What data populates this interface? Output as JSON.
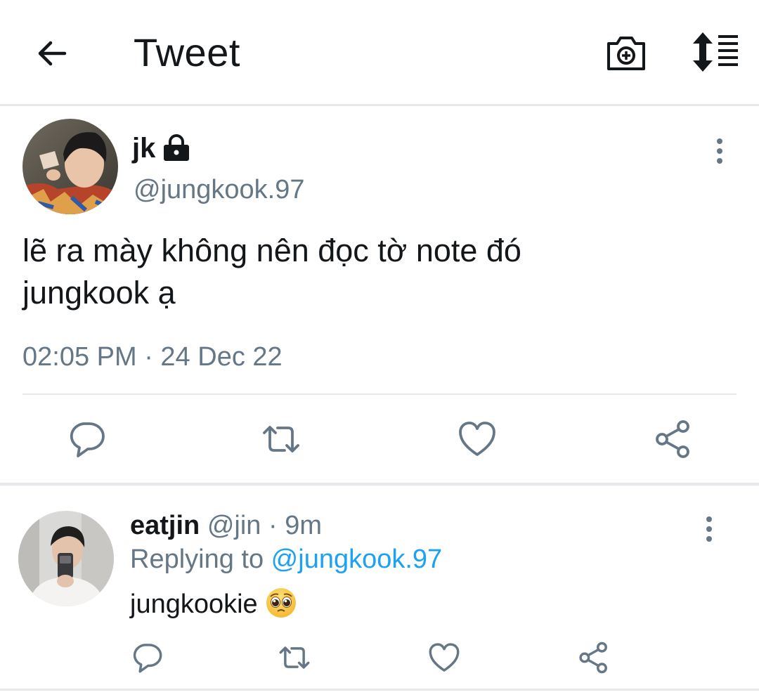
{
  "header": {
    "title": "Tweet",
    "icons": [
      "back-arrow-icon",
      "camera-add-icon",
      "sort-icon"
    ]
  },
  "main_tweet": {
    "display_name": "jk",
    "handle": "@jungkook.97",
    "protected_icon": "lock-icon",
    "text_lines": [
      "lẽ ra mày không nên đọc tờ note đó",
      "jungkook ạ"
    ],
    "timestamp": "02:05 PM · 24 Dec 22",
    "actions": [
      "reply-icon",
      "retweet-icon",
      "like-icon",
      "share-icon"
    ]
  },
  "reply": {
    "display_name": "eatjin",
    "handle": "@jin",
    "separator": " · ",
    "time_ago": "9m",
    "replying_prefix": "Replying to ",
    "replying_to": "@jungkook.97",
    "text": "jungkookie",
    "emoji": "pleading-face-emoji",
    "actions": [
      "reply-icon",
      "retweet-icon",
      "like-icon",
      "share-icon"
    ]
  },
  "colors": {
    "text_primary": "#14171a",
    "text_secondary": "#657786",
    "link": "#1da1f2",
    "divider": "#e6e9ec"
  }
}
